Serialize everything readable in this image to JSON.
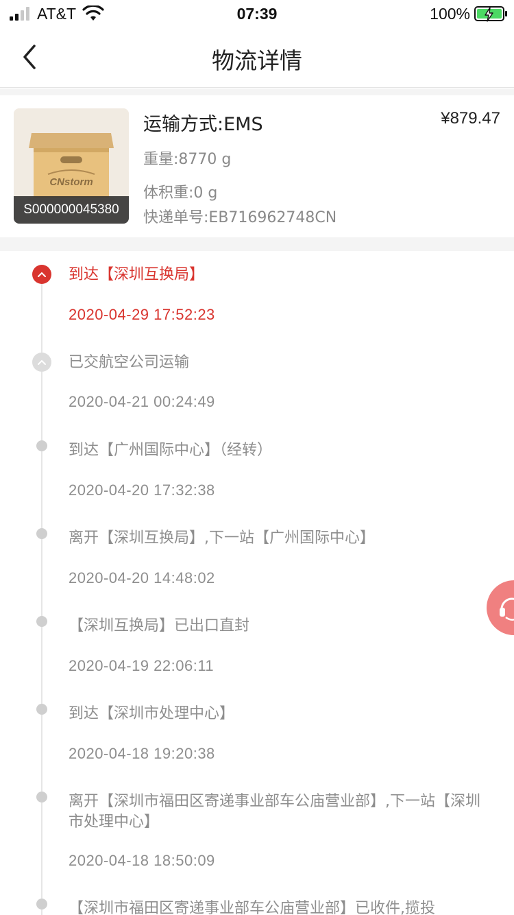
{
  "status_bar": {
    "carrier": "AT&T",
    "time": "07:39",
    "battery": "100%"
  },
  "nav": {
    "title": "物流详情"
  },
  "package": {
    "id": "S000000045380",
    "method": "运输方式:EMS",
    "price": "¥879.47",
    "weight": "重量:8770 g",
    "volume_weight": "体积重:0 g",
    "tracking": "快递单号:EB716962748CN",
    "image_brand": "CNstorm"
  },
  "timeline": [
    {
      "text": "到达【深圳互换局】",
      "time": "2020-04-29 17:52:23",
      "current": true
    },
    {
      "text": "已交航空公司运输",
      "time": "2020-04-21 00:24:49"
    },
    {
      "text": "到达【广州国际中心】（经转）",
      "time": "2020-04-20 17:32:38"
    },
    {
      "text": "离开【深圳互换局】,下一站【广州国际中心】",
      "time": "2020-04-20 14:48:02"
    },
    {
      "text": "【深圳互换局】已出口直封",
      "time": "2020-04-19 22:06:11"
    },
    {
      "text": "到达【深圳市处理中心】",
      "time": "2020-04-18 19:20:38"
    },
    {
      "text": "离开【深圳市福田区寄递事业部车公庙营业部】,下一站【深圳市处理中心】",
      "time": "2020-04-18 18:50:09"
    },
    {
      "text": "【深圳市福田区寄递事业部车公庙营业部】已收件,揽投"
    }
  ],
  "colors": {
    "accent": "#d9352f",
    "muted_text": "#8e8e8e",
    "service_button": "#f08080"
  }
}
